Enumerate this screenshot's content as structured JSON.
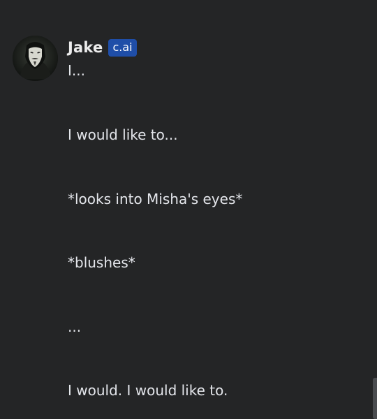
{
  "message": {
    "author": "Jake",
    "badge": "c.ai",
    "avatar_icon": "masked-face-avatar",
    "lines": [
      "I...",
      "I would like to...",
      "*looks into Misha's eyes*",
      "*blushes*",
      "...",
      "I would. I would like to."
    ]
  },
  "colors": {
    "background": "#242526",
    "text": "#e4e6eb",
    "badge": "#1f4ea8"
  }
}
